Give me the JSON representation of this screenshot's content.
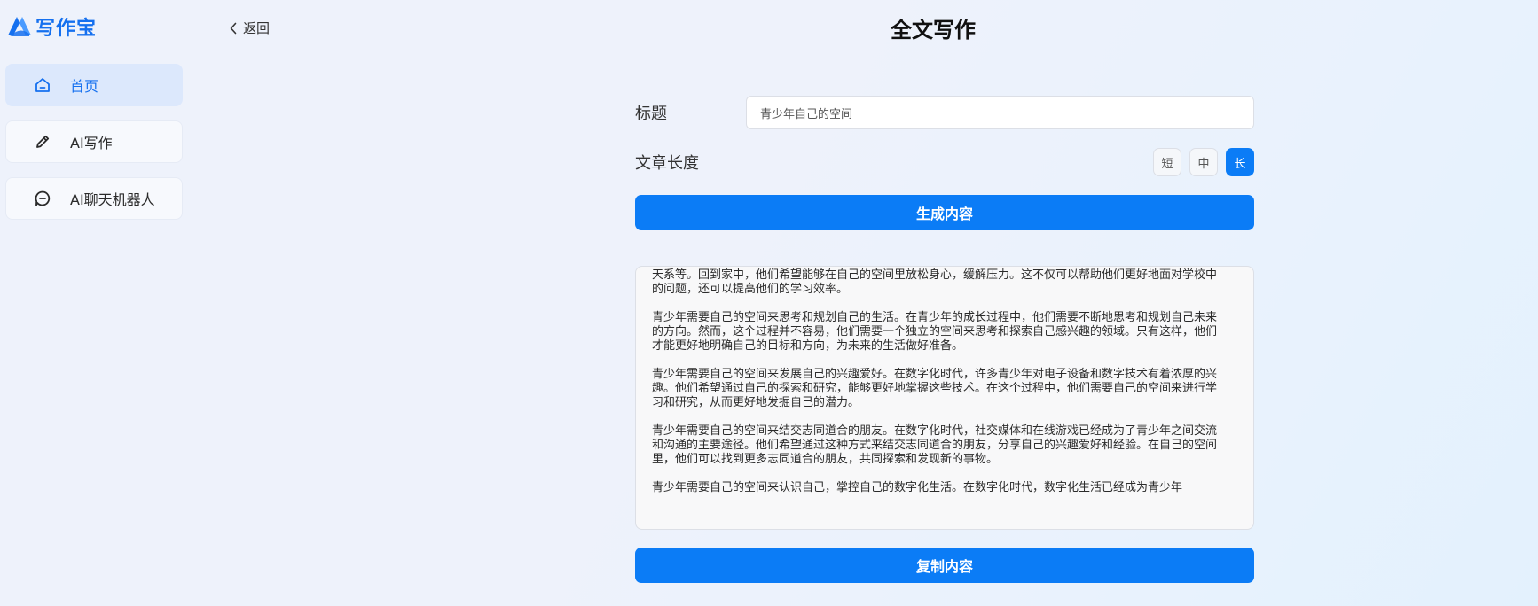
{
  "app": {
    "logo_text": "写作宝"
  },
  "sidebar": {
    "items": [
      {
        "label": "首页",
        "icon": "home-icon",
        "active": true
      },
      {
        "label": "AI写作",
        "icon": "pen-icon",
        "active": false
      },
      {
        "label": "AI聊天机器人",
        "icon": "chat-icon",
        "active": false
      }
    ]
  },
  "header": {
    "back_label": "返回",
    "title": "全文写作"
  },
  "form": {
    "title_label": "标题",
    "title_value": "青少年自己的空间",
    "length_label": "文章长度",
    "length_options": [
      "短",
      "中",
      "长"
    ],
    "length_selected": "长",
    "generate_label": "生成内容",
    "copy_label": "复制内容"
  },
  "content": {
    "paragraphs": [
      "天系等。回到家中，他们希望能够在自己的空间里放松身心，缓解压力。这不仅可以帮助他们更好地面对学校中的问题，还可以提高他们的学习效率。",
      "青少年需要自己的空间来思考和规划自己的生活。在青少年的成长过程中，他们需要不断地思考和规划自己未来的方向。然而，这个过程并不容易，他们需要一个独立的空间来思考和探索自己感兴趣的领域。只有这样，他们才能更好地明确自己的目标和方向，为未来的生活做好准备。",
      "青少年需要自己的空间来发展自己的兴趣爱好。在数字化时代，许多青少年对电子设备和数字技术有着浓厚的兴趣。他们希望通过自己的探索和研究，能够更好地掌握这些技术。在这个过程中，他们需要自己的空间来进行学习和研究，从而更好地发掘自己的潜力。",
      "青少年需要自己的空间来结交志同道合的朋友。在数字化时代，社交媒体和在线游戏已经成为了青少年之间交流和沟通的主要途径。他们希望通过这种方式来结交志同道合的朋友，分享自己的兴趣爱好和经验。在自己的空间里，他们可以找到更多志同道合的朋友，共同探索和发现新的事物。",
      "青少年需要自己的空间来认识自己，掌控自己的数字化生活。在数字化时代，数字化生活已经成为青少年"
    ]
  },
  "colors": {
    "accent": "#0b7cf6",
    "logo": "#1570ef",
    "active_nav_bg": "#dce8fc"
  }
}
